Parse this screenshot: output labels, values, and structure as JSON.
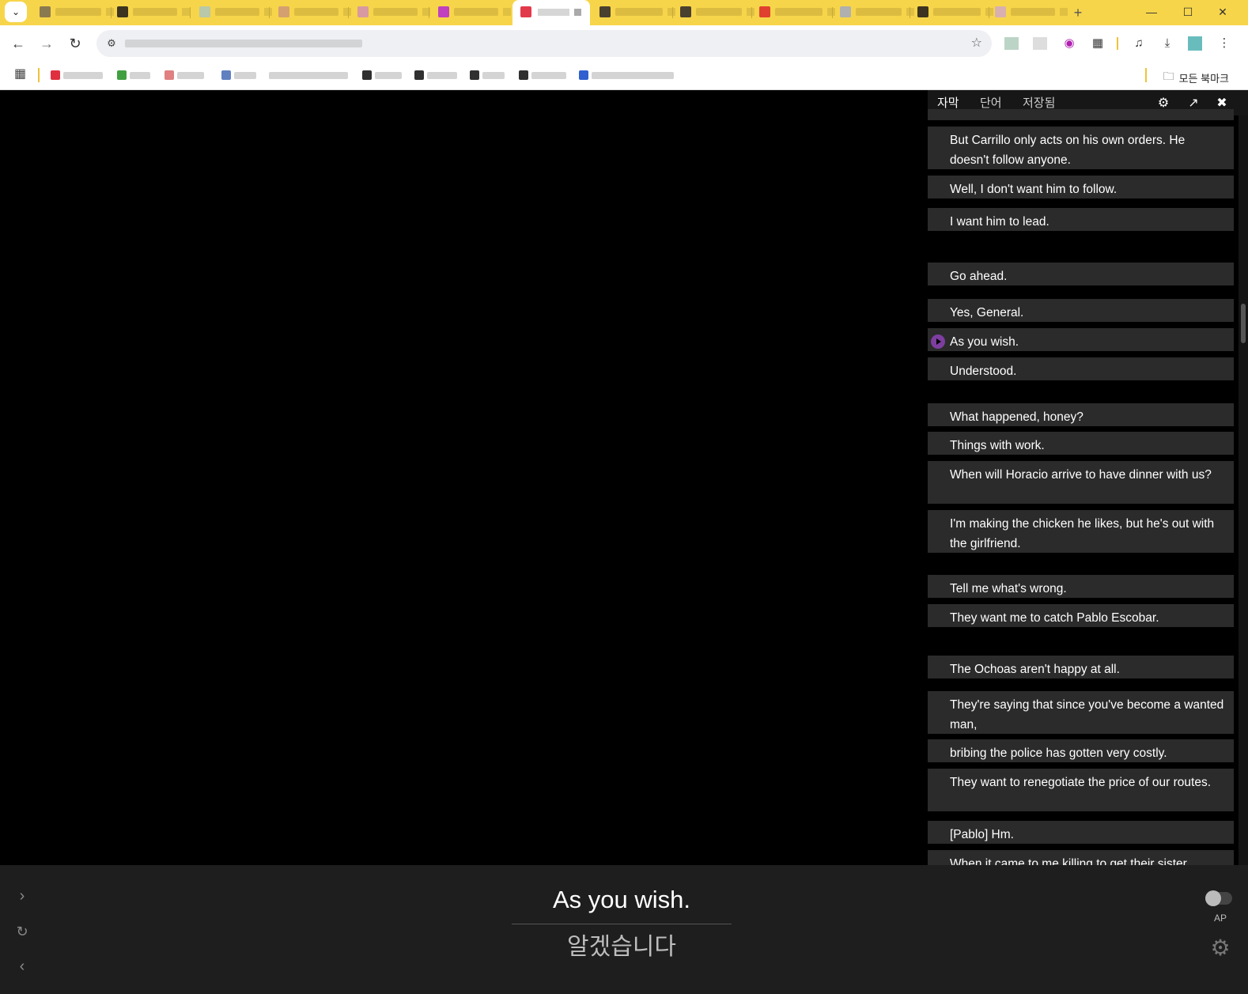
{
  "browser": {
    "bookmarks_all_label": "모든 북마크",
    "icons": {
      "tab_search": "chevron-down-icon",
      "back": "arrow-left-icon",
      "forward": "arrow-right-icon",
      "reload": "reload-icon",
      "site_info": "tune-icon",
      "bookmark_star": "star-icon",
      "extensions": "puzzle-icon",
      "media": "media-queue-icon",
      "downloads": "download-icon",
      "menu": "kebab-menu-icon",
      "apps": "apps-grid-icon",
      "folder": "folder-icon"
    },
    "accent_color": "#f7d54a"
  },
  "sidebar": {
    "tabs": [
      "자막",
      "단어",
      "저장됨"
    ],
    "active_tab": "자막",
    "subtitles": [
      "But Carrillo only acts on his own orders. He doesn't follow anyone.",
      "Well, I don't want him to follow.",
      "I want him to lead.",
      "Go ahead.",
      "Yes, General.",
      "As you wish.",
      "Understood.",
      "What happened, honey?",
      "Things with work.",
      "When will Horacio arrive to have dinner with us?",
      "I'm making the chicken he likes, but he's out with the girlfriend.",
      "Tell me what's wrong.",
      "They want me to catch Pablo Escobar.",
      "The Ochoas aren't happy at all.",
      "They're saying that since you've become a wanted man,",
      "bribing the police has gotten very costly.",
      "They want to renegotiate the price of our routes.",
      "[Pablo] Hm.",
      "When it came to me killing to get their sister"
    ],
    "playing_index": 5,
    "play_color": "#7d3ea0"
  },
  "player": {
    "current_subtitle": "As you wish.",
    "translation": "알겠습니다",
    "autoplay_label": "AP",
    "autoplay_on": false
  }
}
